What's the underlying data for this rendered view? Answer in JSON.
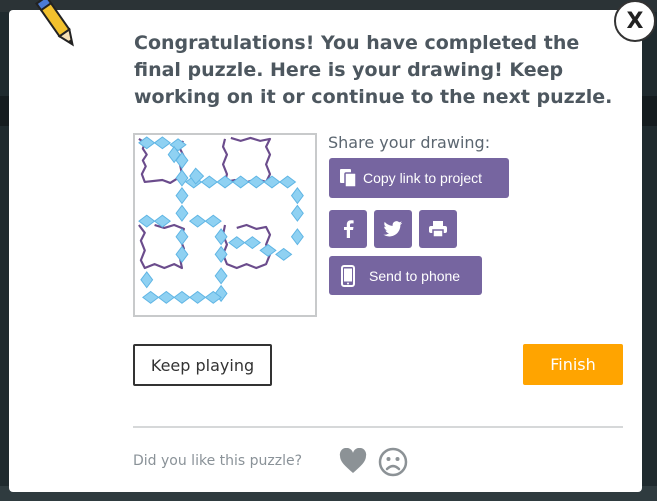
{
  "dialog": {
    "message": "Congratulations! You have completed the final puzzle. Here is your drawing! Keep working on it or continue to the next puzzle.",
    "close_label": "X"
  },
  "share": {
    "label": "Share your drawing:",
    "copy_link_label": "Copy link to project",
    "send_to_phone_label": "Send to phone",
    "icons": [
      "copy-icon",
      "facebook-icon",
      "twitter-icon",
      "print-icon",
      "phone-icon"
    ]
  },
  "actions": {
    "keep_playing_label": "Keep playing",
    "finish_label": "Finish"
  },
  "feedback": {
    "question": "Did you like this puzzle?",
    "icons": [
      "heart-icon",
      "sad-face-icon"
    ]
  },
  "colors": {
    "finish": "#ffa400",
    "share_buttons": "#7665a0",
    "drawing_purple": "#6b4c8c",
    "drawing_blue": "#7fc8ef"
  }
}
